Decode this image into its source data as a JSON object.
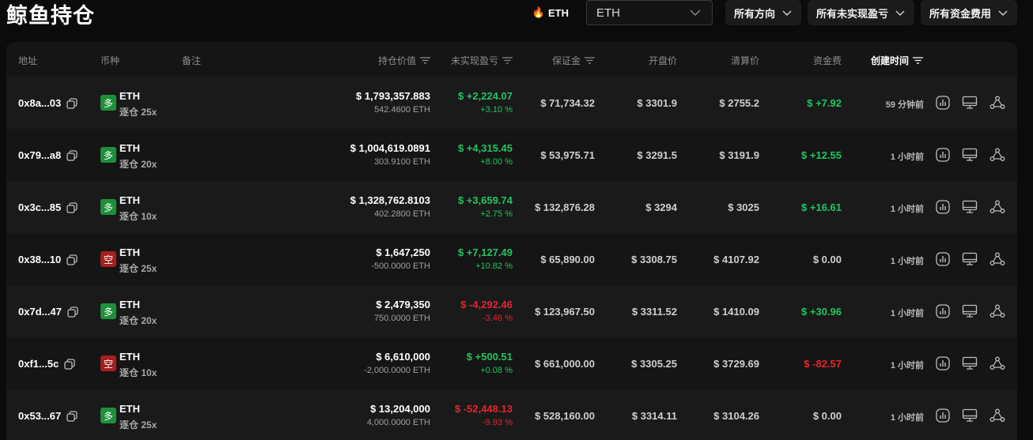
{
  "page": {
    "title": "鲸鱼持仓"
  },
  "controls": {
    "coin_tag": "ETH",
    "coin_select_value": "ETH",
    "filters": [
      "所有方向",
      "所有未实现盈亏",
      "所有资金费用"
    ]
  },
  "table": {
    "headers": {
      "address": "地址",
      "coin": "币种",
      "note": "备注",
      "value": "持仓价值",
      "pnl": "未实现盈亏",
      "margin": "保证金",
      "open": "开盘价",
      "liq": "清算价",
      "fee": "资金费",
      "created": "创建时间"
    },
    "rows": [
      {
        "address": "0x8a...03",
        "side": "多",
        "coin": "ETH",
        "leverage": "逐仓 25x",
        "value": "$ 1,793,357.883",
        "size": "542.4600 ETH",
        "pnl": "$ +2,224.07",
        "pnl_pct": "+3.10 %",
        "margin": "$ 71,734.32",
        "open": "$ 3301.9",
        "liq": "$ 2755.2",
        "fee": "$ +7.92",
        "time": "59 分钟前"
      },
      {
        "address": "0x79...a8",
        "side": "多",
        "coin": "ETH",
        "leverage": "逐仓 20x",
        "value": "$ 1,004,619.0891",
        "size": "303.9100 ETH",
        "pnl": "$ +4,315.45",
        "pnl_pct": "+8.00 %",
        "margin": "$ 53,975.71",
        "open": "$ 3291.5",
        "liq": "$ 3191.9",
        "fee": "$ +12.55",
        "time": "1 小时前"
      },
      {
        "address": "0x3c...85",
        "side": "多",
        "coin": "ETH",
        "leverage": "逐仓 10x",
        "value": "$ 1,328,762.8103",
        "size": "402.2800 ETH",
        "pnl": "$ +3,659.74",
        "pnl_pct": "+2.75 %",
        "margin": "$ 132,876.28",
        "open": "$ 3294",
        "liq": "$ 3025",
        "fee": "$ +16.61",
        "time": "1 小时前"
      },
      {
        "address": "0x38...10",
        "side": "空",
        "coin": "ETH",
        "leverage": "逐仓 25x",
        "value": "$ 1,647,250",
        "size": "-500.0000 ETH",
        "pnl": "$ +7,127.49",
        "pnl_pct": "+10.82 %",
        "margin": "$ 65,890.00",
        "open": "$ 3308.75",
        "liq": "$ 4107.92",
        "fee": "$ 0.00",
        "time": "1 小时前"
      },
      {
        "address": "0x7d...47",
        "side": "多",
        "coin": "ETH",
        "leverage": "逐仓 20x",
        "value": "$ 2,479,350",
        "size": "750.0000 ETH",
        "pnl": "$ -4,292.46",
        "pnl_pct": "-3.46 %",
        "margin": "$ 123,967.50",
        "open": "$ 3311.52",
        "liq": "$ 1410.09",
        "fee": "$ +30.96",
        "time": "1 小时前"
      },
      {
        "address": "0xf1...5c",
        "side": "空",
        "coin": "ETH",
        "leverage": "逐仓 10x",
        "value": "$ 6,610,000",
        "size": "-2,000.0000 ETH",
        "pnl": "$ +500.51",
        "pnl_pct": "+0.08 %",
        "margin": "$ 661,000.00",
        "open": "$ 3305.25",
        "liq": "$ 3729.69",
        "fee": "$ -82.57",
        "time": "1 小时前"
      },
      {
        "address": "0x53...67",
        "side": "多",
        "coin": "ETH",
        "leverage": "逐仓 25x",
        "value": "$ 13,204,000",
        "size": "4,000.0000 ETH",
        "pnl": "$ -52,448.13",
        "pnl_pct": "-9.93 %",
        "margin": "$ 528,160.00",
        "open": "$ 3314.11",
        "liq": "$ 3104.26",
        "fee": "$ 0.00",
        "time": "1 小时前"
      }
    ]
  },
  "colors": {
    "positive": "#22c55e",
    "negative": "#e5242c",
    "long_badge": "#1e8f3a",
    "short_badge": "#a61e1e"
  },
  "icons": {
    "row_actions": [
      "chart-icon",
      "monitor-icon",
      "share-icon"
    ],
    "copy": "copy-icon",
    "fire": "fire-icon"
  }
}
